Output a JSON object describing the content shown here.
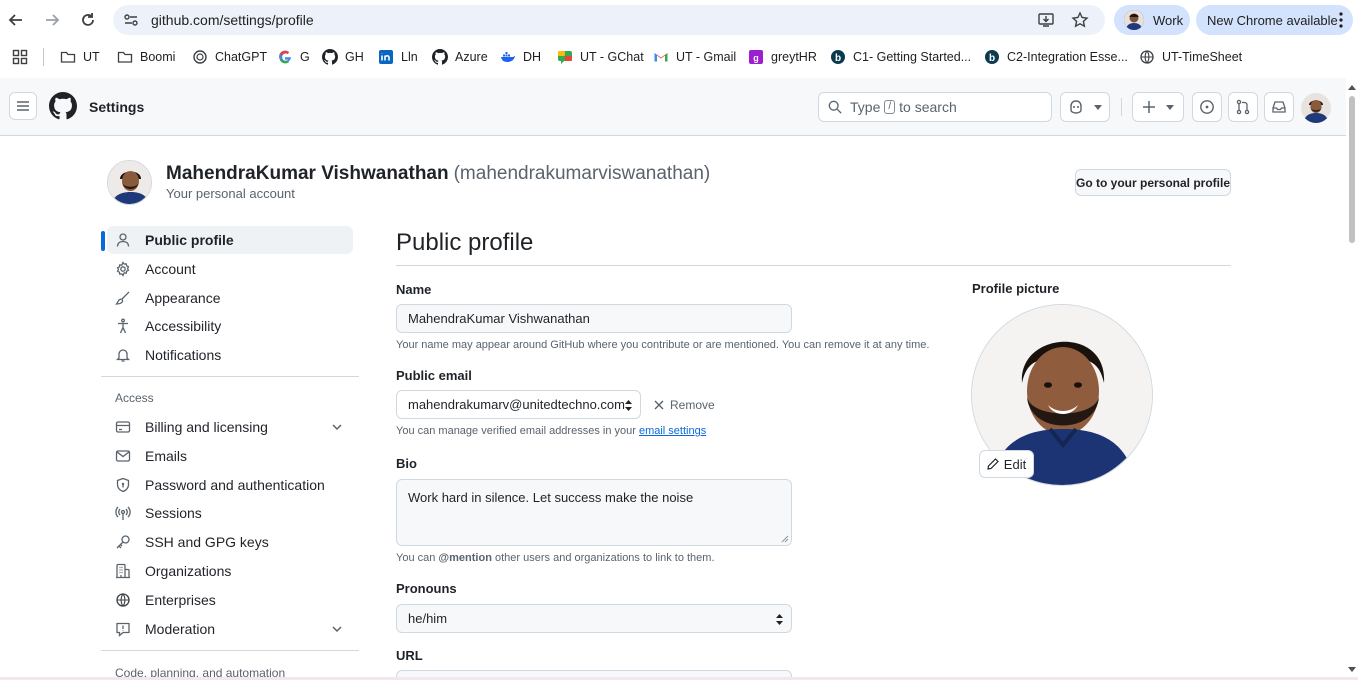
{
  "browser": {
    "url": "github.com/settings/profile",
    "profile_label": "Work",
    "update_label": "New Chrome available",
    "bookmarks": [
      {
        "label": "UT",
        "icon": "folder-icon"
      },
      {
        "label": "Boomi",
        "icon": "folder-icon"
      },
      {
        "label": "ChatGPT",
        "icon": "chatgpt-icon"
      },
      {
        "label": "G",
        "icon": "google-icon"
      },
      {
        "label": "GH",
        "icon": "github-icon"
      },
      {
        "label": "Lln",
        "icon": "linkedin-icon"
      },
      {
        "label": "Azure",
        "icon": "github-icon"
      },
      {
        "label": "DH",
        "icon": "docker-icon"
      },
      {
        "label": "UT - GChat",
        "icon": "gchat-icon"
      },
      {
        "label": "UT - Gmail",
        "icon": "gmail-icon"
      },
      {
        "label": "greytHR",
        "icon": "greythr-icon"
      },
      {
        "label": "C1- Getting Started...",
        "icon": "b-icon"
      },
      {
        "label": "C2-Integration Esse...",
        "icon": "b-icon"
      },
      {
        "label": "UT-TimeSheet",
        "icon": "globe-icon"
      }
    ]
  },
  "header": {
    "title": "Settings",
    "search_prefix": "Type",
    "search_key": "/",
    "search_suffix": "to search"
  },
  "account": {
    "display_name": "MahendraKumar Vishwanathan",
    "handle": "(mahendrakumarviswanathan)",
    "subtitle": "Your personal account",
    "profile_button": "Go to your personal profile"
  },
  "sidebar": {
    "items": [
      {
        "label": "Public profile",
        "icon": "person-icon",
        "active": true
      },
      {
        "label": "Account",
        "icon": "gear-icon"
      },
      {
        "label": "Appearance",
        "icon": "paintbrush-icon"
      },
      {
        "label": "Accessibility",
        "icon": "accessibility-icon"
      },
      {
        "label": "Notifications",
        "icon": "bell-icon"
      }
    ],
    "access_group": "Access",
    "access_items": [
      {
        "label": "Billing and licensing",
        "icon": "credit-card-icon",
        "expandable": true
      },
      {
        "label": "Emails",
        "icon": "mail-icon"
      },
      {
        "label": "Password and authentication",
        "icon": "shield-lock-icon"
      },
      {
        "label": "Sessions",
        "icon": "broadcast-icon"
      },
      {
        "label": "SSH and GPG keys",
        "icon": "key-icon"
      },
      {
        "label": "Organizations",
        "icon": "organization-icon"
      },
      {
        "label": "Enterprises",
        "icon": "globe-icon"
      },
      {
        "label": "Moderation",
        "icon": "report-icon",
        "expandable": true
      }
    ],
    "code_group": "Code, planning, and automation"
  },
  "main": {
    "title": "Public profile",
    "name_label": "Name",
    "name_value": "MahendraKumar Vishwanathan",
    "name_note": "Your name may appear around GitHub where you contribute or are mentioned. You can remove it at any time.",
    "email_label": "Public email",
    "email_value": "mahendrakumarv@unitedtechno.com",
    "remove_label": "Remove",
    "email_note_prefix": "You can manage verified email addresses in your",
    "email_note_link": "email settings",
    "bio_label": "Bio",
    "bio_value": "Work hard in silence. Let success make the noise",
    "bio_note_prefix": "You can",
    "bio_note_mention": "@mention",
    "bio_note_suffix": "other users and organizations to link to them.",
    "pronouns_label": "Pronouns",
    "pronouns_value": "he/him",
    "url_label": "URL",
    "picture_label": "Profile picture",
    "edit_label": "Edit"
  },
  "colors": {
    "accent": "#0969da",
    "chrome_chip": "#d3e3fd",
    "omnibox": "#edf2fa"
  }
}
